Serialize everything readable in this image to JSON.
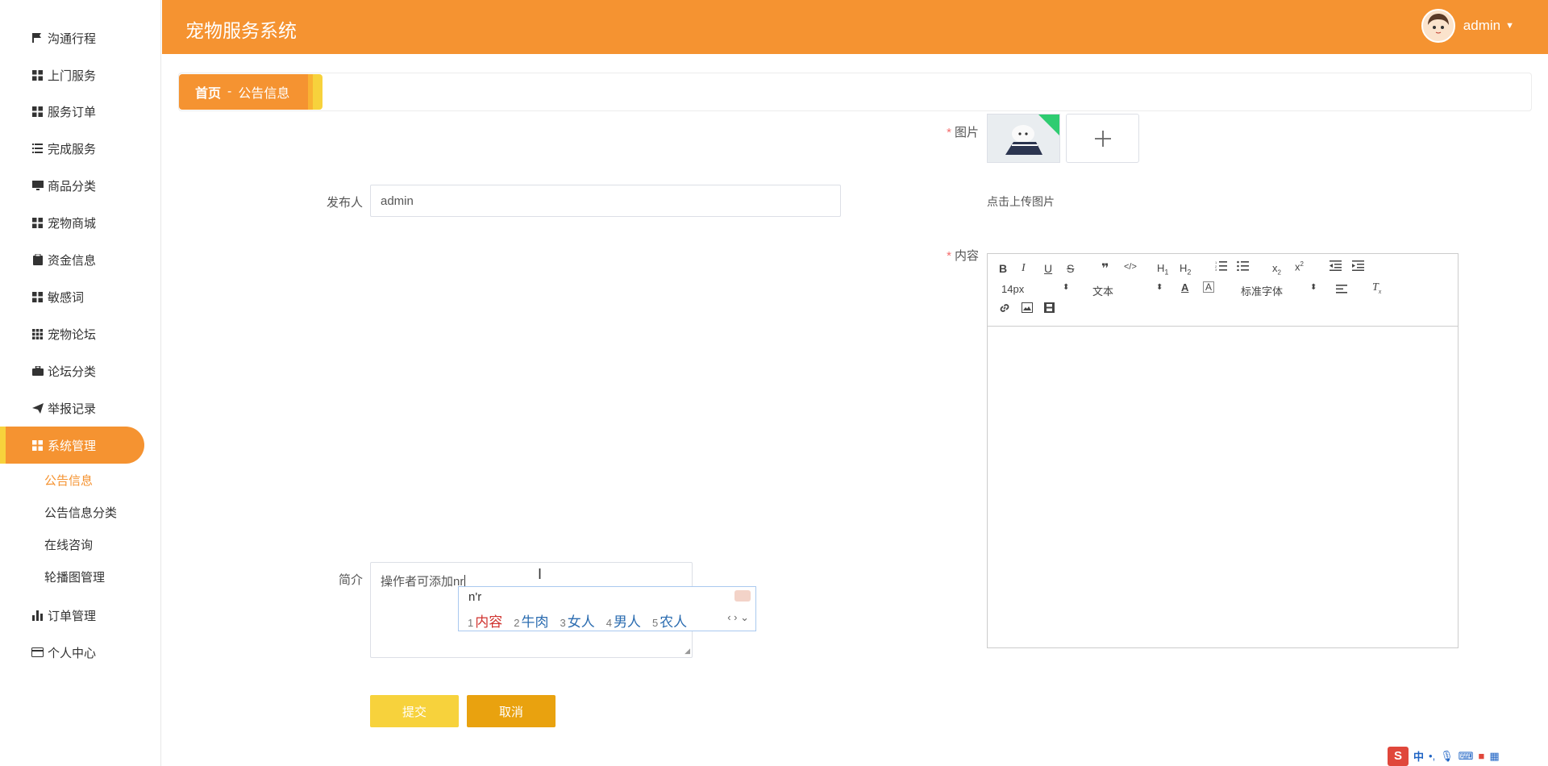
{
  "header": {
    "title": "宠物服务系统",
    "user": "admin"
  },
  "sidebar": {
    "items": [
      {
        "label": "沟通行程",
        "icon": "flag-icon"
      },
      {
        "label": "上门服务",
        "icon": "grid-icon"
      },
      {
        "label": "服务订单",
        "icon": "grid-icon"
      },
      {
        "label": "完成服务",
        "icon": "list-icon"
      },
      {
        "label": "商品分类",
        "icon": "monitor-icon"
      },
      {
        "label": "宠物商城",
        "icon": "grid-icon"
      },
      {
        "label": "资金信息",
        "icon": "clipboard-icon"
      },
      {
        "label": "敏感词",
        "icon": "grid-icon"
      },
      {
        "label": "宠物论坛",
        "icon": "apps-icon"
      },
      {
        "label": "论坛分类",
        "icon": "briefcase-icon"
      },
      {
        "label": "举报记录",
        "icon": "send-icon"
      },
      {
        "label": "系统管理",
        "icon": "grid-icon"
      }
    ],
    "sub_items": [
      "公告信息",
      "公告信息分类",
      "在线咨询",
      "轮播图管理"
    ],
    "bottom_items": [
      {
        "label": "订单管理",
        "icon": "bar-chart-icon"
      },
      {
        "label": "个人中心",
        "icon": "card-icon"
      }
    ]
  },
  "breadcrumb": {
    "home": "首页",
    "separator": "-",
    "current": "公告信息"
  },
  "form": {
    "publisher_label": "发布人",
    "publisher_value": "admin",
    "image_label": "图片",
    "upload_hint": "点击上传图片",
    "content_label": "内容",
    "summary_label": "简介",
    "summary_value": "操作者可添加nr",
    "required_mark": "*"
  },
  "editor": {
    "font_size": "14px",
    "block_type": "文本",
    "font_family": "标准字体",
    "tools": [
      "B",
      "I",
      "U",
      "S",
      "❞",
      "</>",
      "H1",
      "H2",
      "ol",
      "ul",
      "x₂",
      "x²",
      "outdent",
      "indent"
    ]
  },
  "ime": {
    "composition": "n'r",
    "candidates": [
      {
        "num": "1",
        "text": "内容"
      },
      {
        "num": "2",
        "text": "牛肉"
      },
      {
        "num": "3",
        "text": "女人"
      },
      {
        "num": "4",
        "text": "男人"
      },
      {
        "num": "5",
        "text": "农人"
      }
    ]
  },
  "buttons": {
    "submit": "提交",
    "cancel": "取消"
  },
  "tray": {
    "logo": "S",
    "mode": "中"
  },
  "colors": {
    "accent": "#f59331",
    "yellow": "#f7d23c",
    "cancel": "#e9a20f"
  }
}
